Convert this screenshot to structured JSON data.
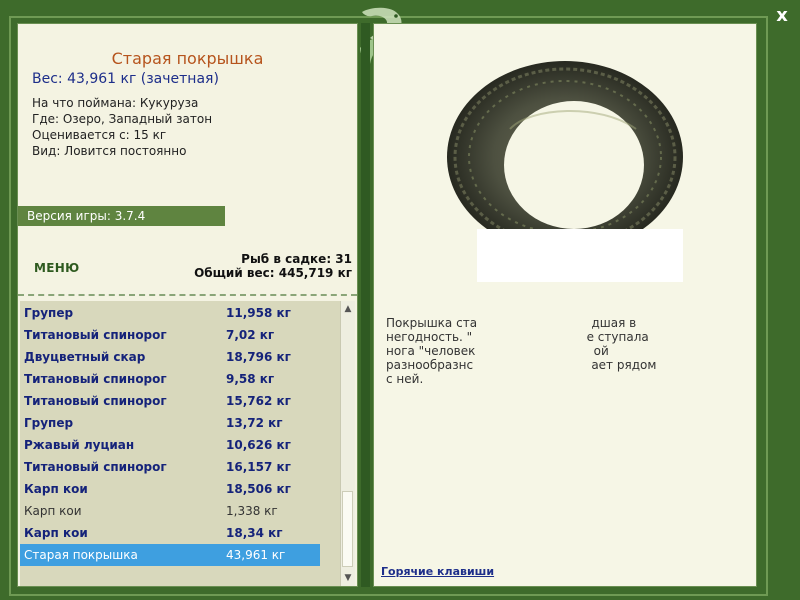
{
  "window": {
    "close_label": "x"
  },
  "fish_info": {
    "title": "Старая покрышка",
    "weight": "Вес: 43,961 кг (зачетная)",
    "bait": "На что поймана: Кукуруза",
    "place": "Где: Озеро, Западный затон",
    "value": "Оценивается с: 15 кг",
    "type": "Вид: Ловится постоянно"
  },
  "version": "Версия игры: 3.7.4",
  "menu_label": "МЕНЮ",
  "stats": {
    "fish_count": "Рыб в садке: 31",
    "total_weight": "Общий вес: 445,719 кг"
  },
  "catch_list": [
    {
      "name": "Групер",
      "weight": "11,958 кг",
      "style": "bold"
    },
    {
      "name": "Титановый спинорог",
      "weight": "7,02 кг",
      "style": "bold"
    },
    {
      "name": "Двуцветный скар",
      "weight": "18,796 кг",
      "style": "bold"
    },
    {
      "name": "Титановый спинорог",
      "weight": "9,58 кг",
      "style": "bold"
    },
    {
      "name": "Титановый спинорог",
      "weight": "15,762 кг",
      "style": "bold"
    },
    {
      "name": "Групер",
      "weight": "13,72 кг",
      "style": "bold"
    },
    {
      "name": "Ржавый луциан",
      "weight": "10,626 кг",
      "style": "bold"
    },
    {
      "name": "Титановый спинорог",
      "weight": "16,157 кг",
      "style": "bold"
    },
    {
      "name": "Карп кои",
      "weight": "18,506 кг",
      "style": "bold"
    },
    {
      "name": "Карп кои",
      "weight": "1,338 кг",
      "style": "normal"
    },
    {
      "name": "Карп кои",
      "weight": "18,34 кг",
      "style": "bold"
    },
    {
      "name": "Старая покрышка",
      "weight": "43,961 кг",
      "style": "selected"
    }
  ],
  "description": {
    "lines": [
      "Покрышка ста                              дшая в",
      "негодность. \"                              е ступала",
      "нога \"человек                               ой",
      "разнообразнс                               ает рядом",
      "с ней."
    ]
  },
  "hotkeys_label": "Горячие клавиши",
  "colors": {
    "frame_green": "#3e6b2b",
    "panel_bg": "#f4f3e2",
    "title_orange": "#b6541d",
    "accent_blue": "#1d2e8a",
    "selected_blue": "#3e9fe0"
  }
}
